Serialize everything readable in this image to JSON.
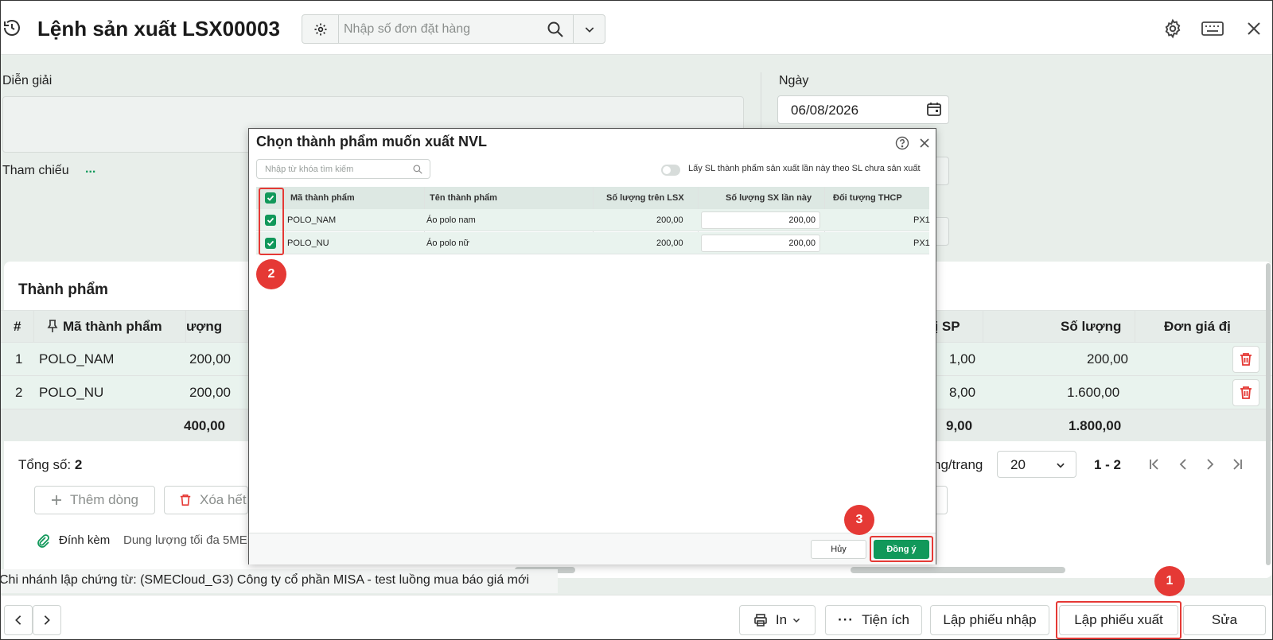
{
  "header": {
    "title": "Lệnh sản xuất LSX00003",
    "search_placeholder": "Nhập số đơn đặt hàng"
  },
  "form": {
    "description_label": "Diễn giải",
    "reference_label": "Tham chiếu",
    "reference_more": "...",
    "date_label": "Ngày",
    "date_value": "06/08/2026"
  },
  "products_panel": {
    "title": "Thành phẩm",
    "columns": [
      "#",
      "Mã thành phẩm",
      "ượng",
      "vị SP",
      "Số lượng",
      "Đơn giá đị"
    ],
    "rows": [
      {
        "no": "1",
        "code": "POLO_NAM",
        "qty": "200,00",
        "unit": "1,00",
        "amount": "200,00"
      },
      {
        "no": "2",
        "code": "POLO_NU",
        "qty": "200,00",
        "unit": "8,00",
        "amount": "1.600,00"
      }
    ],
    "totals": {
      "qty": "400,00",
      "unit": "9,00",
      "amount": "1.800,00"
    },
    "total_count_label": "Tổng số:",
    "total_count_value": "2",
    "per_page_label": "ng/trang",
    "per_page_value": "20",
    "range_label": "1 - 2",
    "add_row_label": "Thêm dòng",
    "delete_all_label": "Xóa hết",
    "attach_label": "Đính kèm",
    "attach_hint": "Dung lượng tối đa 5ME"
  },
  "status_bar": {
    "text": "Chi nhánh lập chứng từ: (SMECloud_G3) Công ty cổ phần MISA - test luồng mua báo giá mới"
  },
  "footer": {
    "print_label": "In",
    "utility_label": "Tiện ích",
    "import_label": "Lập phiếu nhập",
    "export_label": "Lập phiếu xuất",
    "edit_label": "Sửa"
  },
  "modal": {
    "title": "Chọn thành phẩm muốn xuất NVL",
    "search_placeholder": "Nhập từ khóa tìm kiếm",
    "toggle_label": "Lấy SL thành phẩm sản xuất lần này theo SL chưa sản xuất",
    "columns": [
      "Mã thành phẩm",
      "Tên thành phẩm",
      "Số lượng trên LSX",
      "Số lượng SX lần này",
      "Đối tượng THCP"
    ],
    "rows": [
      {
        "code": "POLO_NAM",
        "name": "Áo polo nam",
        "qty_lsx": "200,00",
        "qty_now": "200,00",
        "target": "PX1"
      },
      {
        "code": "POLO_NU",
        "name": "Áo polo nữ",
        "qty_lsx": "200,00",
        "qty_now": "200,00",
        "target": "PX1"
      }
    ],
    "cancel_label": "Hủy",
    "ok_label": "Đồng ý"
  },
  "annotations": {
    "marker_1": "1",
    "marker_2": "2",
    "marker_3": "3"
  },
  "colors": {
    "accent": "#11985a",
    "highlight": "#e53935",
    "row_alt": "#e9f3ee"
  }
}
